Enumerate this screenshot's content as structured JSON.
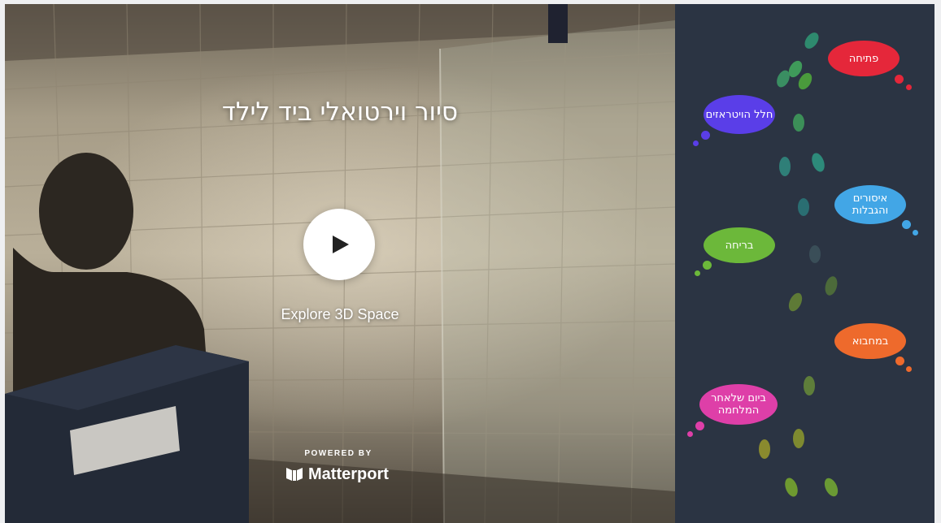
{
  "viewer": {
    "title": "סיור וירטואלי ביד לילד",
    "explore_label": "Explore 3D Space",
    "powered_by": "POWERED BY",
    "brand": "Matterport"
  },
  "nav": {
    "opening": "פתיחה",
    "stained_glass": "חלל הויטראזים",
    "restrictions": "איסורים והגבלות",
    "escape": "בריחה",
    "hiding": "במחבוא",
    "after_war": "ביום שלאחר המלחמה"
  },
  "colors": {
    "panel_bg": "#2b3443",
    "opening": "#e5273a",
    "stained_glass": "#5a3ee8",
    "restrictions": "#42a6e6",
    "escape": "#6cb83a",
    "hiding": "#ee6a2c",
    "after_war": "#de3fa8"
  }
}
